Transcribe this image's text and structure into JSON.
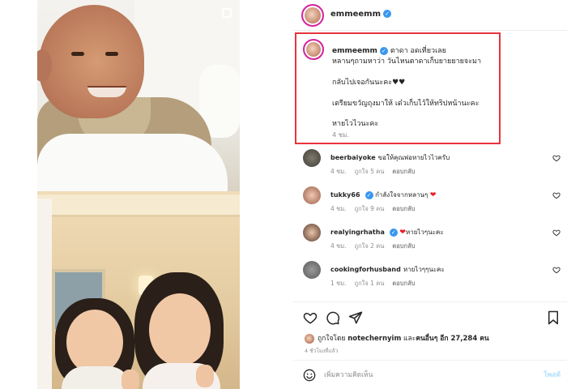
{
  "post": {
    "username": "emmeemm",
    "media_alt_icon": "camera-icon"
  },
  "caption": {
    "username": "emmeemm",
    "line1": "ตาดา อดเที่ยวเลย",
    "line2": "หลานๆถามหาว่า วันไหนตาดาเก็บยายยายจะมา",
    "line3": "กลับไปเจอกันนะคะ♥♥",
    "line4": "เตรียมขวัญถุงมาให้ เด๋วเก็บไว้ให้ทริปหน้านะคะ",
    "line5": "หายไวไวนะคะ",
    "time": "4 ชม."
  },
  "comments": [
    {
      "username": "beerbaiyoke",
      "text": "ขอให้คุณพ่อหายไวไวครับ",
      "time": "4 ชม.",
      "likes": "ถูกใจ 5 คน",
      "reply": "ตอบกลับ"
    },
    {
      "username": "tukky66",
      "text": "กำลังใจจากหลานๆ",
      "time": "4 ชม.",
      "likes": "ถูกใจ 9 คน",
      "reply": "ตอบกลับ"
    },
    {
      "username": "realyingrhatha",
      "text": "หายไวๆนะคะ",
      "time": "4 ชม.",
      "likes": "ถูกใจ 2 คน",
      "reply": "ตอบกลับ"
    },
    {
      "username": "cookingforhusband",
      "text": "หายไวๆๆนะคะ",
      "time": "1 ชม.",
      "likes": "ถูกใจ 1 คน",
      "reply": "ตอบกลับ"
    }
  ],
  "likes": {
    "prefix": "ถูกใจโดย",
    "user": "notechernyim",
    "middle": "และ",
    "others": "คนอื่นๆ อีก 27,284 คน"
  },
  "ago": "4 ชั่วโมงที่แล้ว",
  "comment_bar": {
    "placeholder": "เพิ่มความคิดเห็น",
    "post_label": "โพสต์"
  },
  "colors": {
    "highlight_border": "#e8343d",
    "verified": "#3897f0",
    "heart": "#ed1c24",
    "post_button": "#b2dffc"
  }
}
